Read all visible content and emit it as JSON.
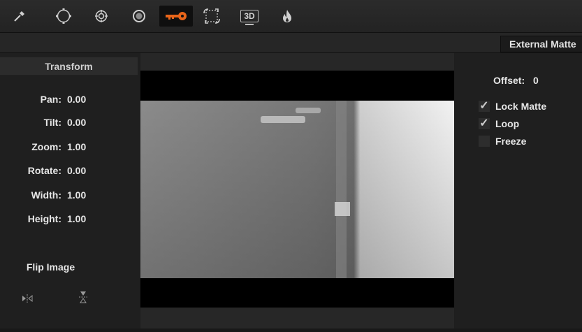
{
  "toolbar": {
    "tools": [
      {
        "icon": "eyedropper-icon",
        "active": false
      },
      {
        "icon": "circle-window-icon",
        "active": false
      },
      {
        "icon": "tracker-icon",
        "active": false
      },
      {
        "icon": "blur-icon",
        "active": false
      },
      {
        "icon": "key-icon",
        "active": true
      },
      {
        "icon": "resize-icon",
        "active": false
      },
      {
        "icon": "3d-icon",
        "label": "3D",
        "active": false
      },
      {
        "icon": "fire-icon",
        "active": false
      }
    ],
    "accent_color": "#e8651a"
  },
  "subbar": {
    "tab_label": "External Matte"
  },
  "transform": {
    "header": "Transform",
    "params": [
      {
        "label": "Pan:",
        "value": "0.00"
      },
      {
        "label": "Tilt:",
        "value": "0.00"
      },
      {
        "label": "Zoom:",
        "value": "1.00"
      },
      {
        "label": "Rotate:",
        "value": "0.00"
      },
      {
        "label": "Width:",
        "value": "1.00"
      },
      {
        "label": "Height:",
        "value": "1.00"
      }
    ],
    "flip_title": "Flip Image",
    "flip_buttons": [
      "flip-horizontal-icon",
      "flip-vertical-icon"
    ]
  },
  "matte": {
    "offset_label": "Offset:",
    "offset_value": "0",
    "options": [
      {
        "label": "Lock Matte",
        "checked": true
      },
      {
        "label": "Loop",
        "checked": true
      },
      {
        "label": "Freeze",
        "checked": false
      }
    ]
  }
}
